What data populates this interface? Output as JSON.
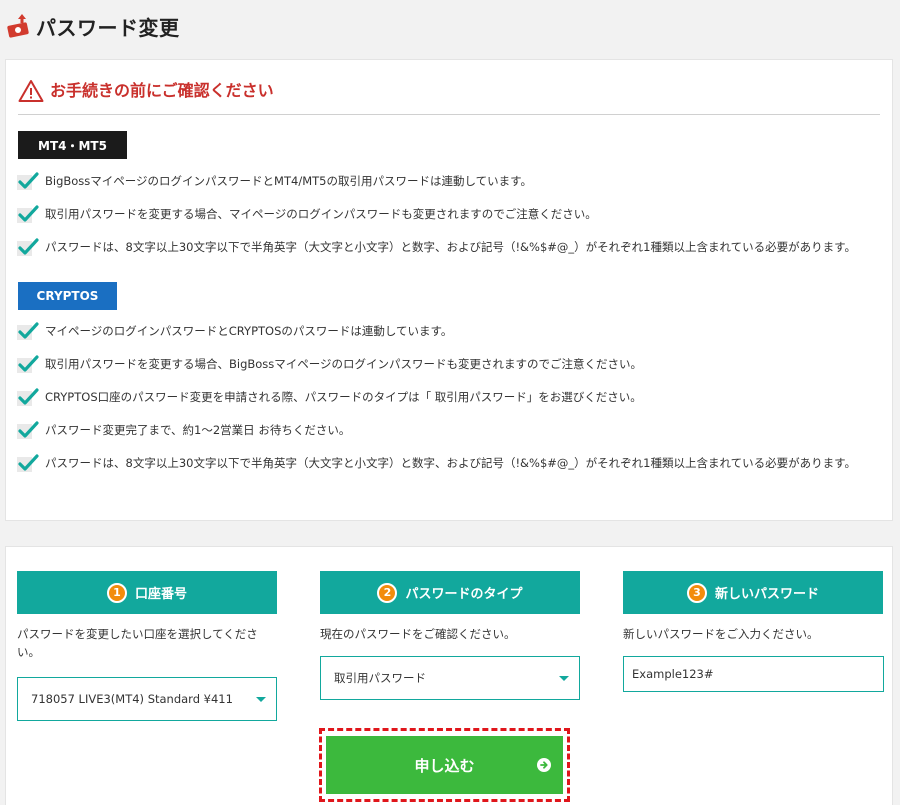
{
  "page": {
    "title": "パスワード変更"
  },
  "notice": {
    "title": "お手続きの前にご確認ください",
    "mt_label": "MT4・MT5",
    "mt_items": [
      "BigBossマイページのログインパスワードとMT4/MT5の取引用パスワードは連動しています。",
      "取引用パスワードを変更する場合、マイページのログインパスワードも変更されますのでご注意ください。",
      "パスワードは、8文字以上30文字以下で半角英字（大文字と小文字）と数字、および記号（!&%$#@_）がそれぞれ1種類以上含まれている必要があります。"
    ],
    "crypto_label": "CRYPTOS",
    "crypto_items": [
      "マイページのログインパスワードとCRYPTOSのパスワードは連動しています。",
      "取引用パスワードを変更する場合、BigBossマイページのログインパスワードも変更されますのでご注意ください。",
      "CRYPTOS口座のパスワード変更を申請される際、パスワードのタイプは「 取引用パスワード」をお選びください。",
      "パスワード変更完了まで、約1〜2営業日 お待ちください。",
      "パスワードは、8文字以上30文字以下で半角英字（大文字と小文字）と数字、および記号（!&%$#@_）がそれぞれ1種類以上含まれている必要があります。"
    ]
  },
  "form": {
    "account": {
      "num": "1",
      "title": "口座番号",
      "desc": "パスワードを変更したい口座を選択してください。",
      "selected": "718057 LIVE3(MT4) Standard ¥411"
    },
    "pw_type": {
      "num": "2",
      "title": "パスワードのタイプ",
      "desc": "現在のパスワードをご確認ください。",
      "selected": "取引用パスワード"
    },
    "new_pw": {
      "num": "3",
      "title": "新しいパスワード",
      "desc": "新しいパスワードをご入力ください。",
      "value": "Example123#"
    },
    "submit_label": "申し込む"
  },
  "colors": {
    "accent": "#12a89d",
    "warning": "#c9302c",
    "submit": "#3cb93d",
    "step_badge": "#f28c0c",
    "mt_label_bg": "#1b1b1b",
    "crypto_label_bg": "#1a6fc2"
  },
  "icons": {
    "header": "money-arrow-icon",
    "warning": "warning-triangle-icon",
    "check": "checkmark-icon",
    "dropdown": "caret-down-icon",
    "submit": "arrow-right-circle-icon"
  }
}
